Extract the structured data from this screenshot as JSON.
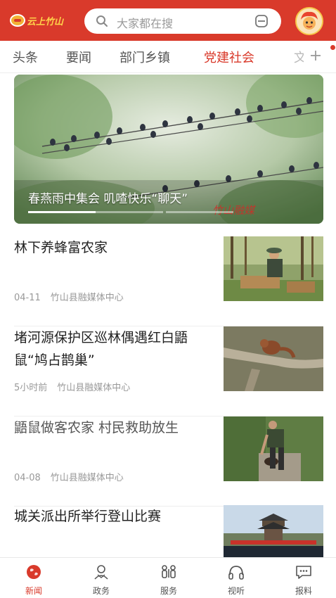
{
  "header": {
    "logo_text": "云上竹山",
    "search_placeholder": "大家都在搜"
  },
  "tabs": [
    {
      "label": "头条",
      "active": false
    },
    {
      "label": "要闻",
      "active": false
    },
    {
      "label": "部门乡镇",
      "active": false
    },
    {
      "label": "党建社会",
      "active": true
    },
    {
      "label": "文",
      "active": false
    }
  ],
  "hero": {
    "caption": "春燕雨中集会  叽喳快乐“聊天”",
    "watermark": "竹山融媒",
    "slide_index": 1,
    "slide_count": 2
  },
  "news": [
    {
      "title": "林下养蜂富农家",
      "date": "04-11",
      "source": "竹山县融媒体中心"
    },
    {
      "title": "堵河源保护区巡林偶遇红白鼯鼠“鸠占鹊巢”",
      "date": "5小时前",
      "source": "竹山县融媒体中心"
    },
    {
      "title": "鼯鼠做客农家  村民救助放生",
      "date": "04-08",
      "source": "竹山县融媒体中心"
    },
    {
      "title": "城关派出所举行登山比赛",
      "date": "",
      "source": ""
    }
  ],
  "bottom_nav": [
    {
      "label": "新闻",
      "icon": "globe-icon",
      "active": true
    },
    {
      "label": "政务",
      "icon": "government-icon",
      "active": false
    },
    {
      "label": "服务",
      "icon": "people-icon",
      "active": false
    },
    {
      "label": "视听",
      "icon": "headphones-icon",
      "active": false
    },
    {
      "label": "报料",
      "icon": "chat-icon",
      "active": false
    }
  ],
  "colors": {
    "brand": "#d93a2b",
    "logo_yellow": "#ffd44a"
  }
}
